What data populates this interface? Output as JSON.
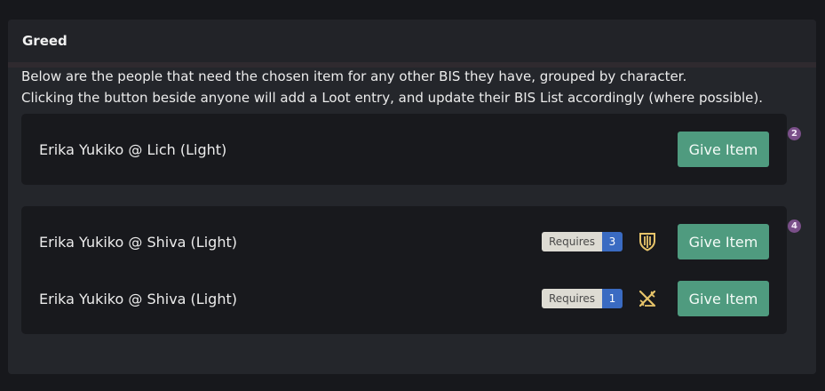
{
  "panel": {
    "title": "Greed"
  },
  "description": {
    "line1": "Below are the people that need the chosen item for any other BIS they have, grouped by character.",
    "line2": "Clicking the button beside anyone will add a Loot entry, and update their BIS List accordingly (where possible)."
  },
  "groups": [
    {
      "count": "2",
      "rows": [
        {
          "name": "Erika Yukiko @ Lich (Light)",
          "button": "Give Item"
        }
      ]
    },
    {
      "count": "4",
      "rows": [
        {
          "name": "Erika Yukiko @ Shiva (Light)",
          "requires_label": "Requires",
          "requires_count": "3",
          "icon": "paladin-shield-icon",
          "button": "Give Item"
        },
        {
          "name": "Erika Yukiko @ Shiva (Light)",
          "requires_label": "Requires",
          "requires_count": "1",
          "icon": "crossed-swords-icon",
          "button": "Give Item"
        }
      ]
    }
  ],
  "colors": {
    "accent_button": "#4f9b7f",
    "count_badge": "#7a4f89",
    "requires_num": "#3a6bc2",
    "job_icon": "#e7c46a"
  }
}
